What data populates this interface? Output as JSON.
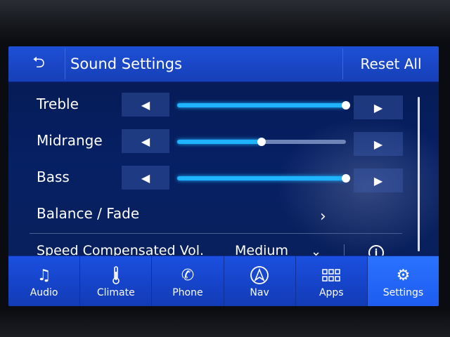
{
  "header": {
    "title": "Sound Settings",
    "reset_label": "Reset All"
  },
  "settings": [
    {
      "label": "Treble",
      "level": 1.0
    },
    {
      "label": "Midrange",
      "level": 0.5
    },
    {
      "label": "Bass",
      "level": 1.0
    }
  ],
  "balance": {
    "label": "Balance / Fade"
  },
  "speed": {
    "label": "Speed Compensated Vol.",
    "value": "Medium"
  },
  "nav": [
    {
      "label": "Audio",
      "icon": "music-note-icon"
    },
    {
      "label": "Climate",
      "icon": "thermometer-icon"
    },
    {
      "label": "Phone",
      "icon": "phone-icon"
    },
    {
      "label": "Nav",
      "icon": "navigation-arrow-icon"
    },
    {
      "label": "Apps",
      "icon": "apps-grid-icon"
    },
    {
      "label": "Settings",
      "icon": "gears-icon",
      "active": true
    }
  ],
  "colors": {
    "accent": "#1fb4ff",
    "header": "#1d4fd6",
    "active_tab": "#2a72ff"
  }
}
